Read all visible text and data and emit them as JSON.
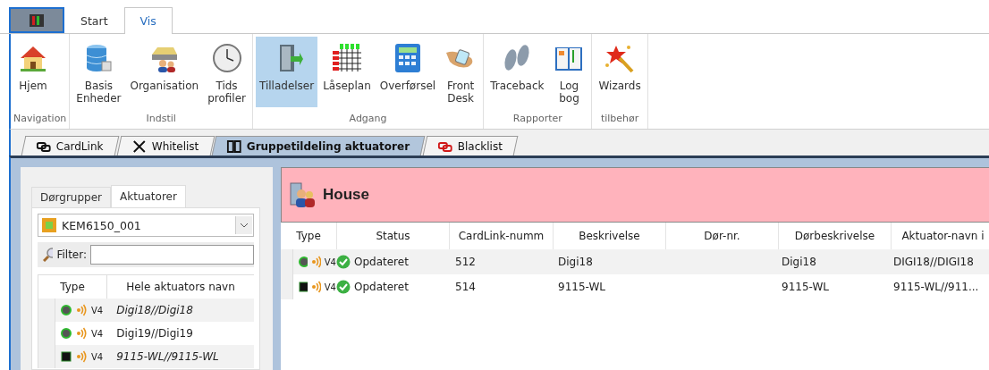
{
  "ribbon_tabs": [
    {
      "label": "Start",
      "selected": false
    },
    {
      "label": "Vis",
      "selected": true
    }
  ],
  "ribbon_groups": [
    {
      "label": "Navigation",
      "buttons": [
        {
          "label": "Hjem",
          "selected": false
        }
      ]
    },
    {
      "label": "Indstil",
      "buttons": [
        {
          "label": "Basis\nEnheder",
          "selected": false
        },
        {
          "label": "Organisation",
          "selected": false
        },
        {
          "label": "Tids\nprofiler",
          "selected": false
        }
      ]
    },
    {
      "label": "Adgang",
      "buttons": [
        {
          "label": "Tilladelser",
          "selected": true
        },
        {
          "label": "Låseplan",
          "selected": false
        },
        {
          "label": "Overførsel",
          "selected": false
        },
        {
          "label": "Front\nDesk",
          "selected": false
        }
      ]
    },
    {
      "label": "Rapporter",
      "buttons": [
        {
          "label": "Traceback",
          "selected": false
        },
        {
          "label": "Log\nbog",
          "selected": false
        }
      ]
    },
    {
      "label": "tilbehør",
      "buttons": [
        {
          "label": "Wizards",
          "selected": false
        }
      ]
    }
  ],
  "doc_tabs": [
    {
      "label": "CardLink",
      "selected": false
    },
    {
      "label": "Whitelist",
      "selected": false
    },
    {
      "label": "Gruppetildeling aktuatorer",
      "selected": true
    },
    {
      "label": "Blacklist",
      "selected": false
    }
  ],
  "left_panel": {
    "tabs": [
      {
        "label": "Dørgrupper",
        "selected": false
      },
      {
        "label": "Aktuatorer",
        "selected": true
      }
    ],
    "dropdown": "KEM6150_001",
    "filter_label": "Filter:",
    "columns": [
      "Type",
      "Hele aktuators navn"
    ],
    "rows": [
      {
        "kind": "dot",
        "version": "V4",
        "name": "Digi18//Digi18",
        "italic": true
      },
      {
        "kind": "dot",
        "version": "V4",
        "name": "Digi19//Digi19",
        "italic": false
      },
      {
        "kind": "chip",
        "version": "V4",
        "name": "9115-WL//9115-WL",
        "italic": true
      }
    ]
  },
  "group": {
    "title": "House",
    "columns": [
      "Type",
      "Status",
      "CardLink-numm",
      "Beskrivelse",
      "Dør-nr.",
      "Dørbeskrivelse",
      "Aktuator-navn i"
    ],
    "rows": [
      {
        "kind": "dot",
        "version": "V4",
        "status": "Opdateret",
        "cardlink": "512",
        "description": "Digi18",
        "door_description": "Digi18",
        "actuator_name": "DIGI18//DIGI18"
      },
      {
        "kind": "chip",
        "version": "V4",
        "status": "Opdateret",
        "cardlink": "514",
        "description": "9115-WL",
        "door_description": "9115-WL",
        "actuator_name": "9115-WL//911..."
      }
    ]
  }
}
